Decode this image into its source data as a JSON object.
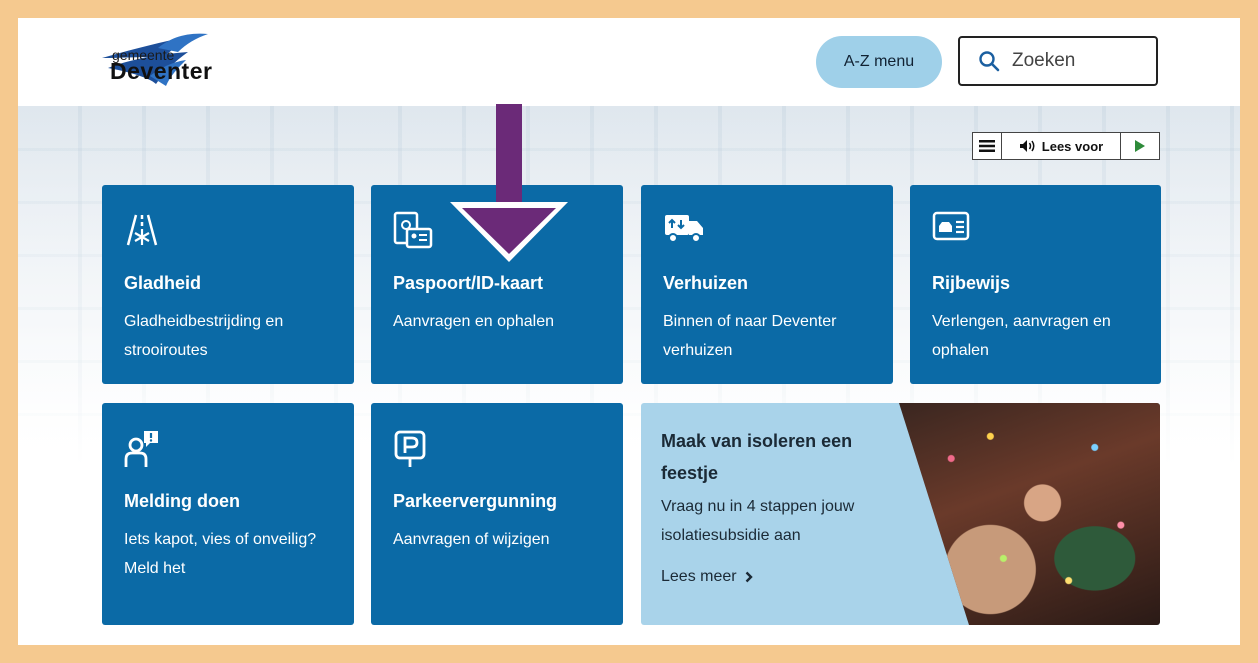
{
  "header": {
    "logo": {
      "line1": "gemeente",
      "line2": "Deventer"
    },
    "az_menu_label": "A-Z menu",
    "search": {
      "placeholder": "Zoeken"
    }
  },
  "readbar": {
    "label": "Lees voor"
  },
  "tiles": [
    {
      "title": "Gladheid",
      "subtitle": "Gladheidbestrijding en strooiroutes",
      "icon": "snow-road-icon"
    },
    {
      "title": "Paspoort/ID-kaart",
      "subtitle": "Aanvragen en ophalen",
      "icon": "passport-id-icon"
    },
    {
      "title": "Verhuizen",
      "subtitle": "Binnen of naar Deventer verhuizen",
      "icon": "moving-truck-icon"
    },
    {
      "title": "Rijbewijs",
      "subtitle": "Verlengen, aanvragen en ophalen",
      "icon": "drivers-license-icon"
    },
    {
      "title": "Melding doen",
      "subtitle": "Iets kapot, vies of onveilig? Meld het",
      "icon": "report-person-icon"
    },
    {
      "title": "Parkeervergunning",
      "subtitle": "Aanvragen of wijzigen",
      "icon": "parking-icon"
    }
  ],
  "promo": {
    "title": "Maak van isoleren een feestje",
    "subtitle": "Vraag nu in 4 stappen jouw isolatiesubsidie aan",
    "link": "Lees meer"
  },
  "colors": {
    "frame": "#f5c98f",
    "tile": "#0b6aa6",
    "az_button": "#9fd0e9",
    "promo": "#a9d3ea",
    "arrow": "#6b2a78",
    "play": "#2e8b3a"
  }
}
